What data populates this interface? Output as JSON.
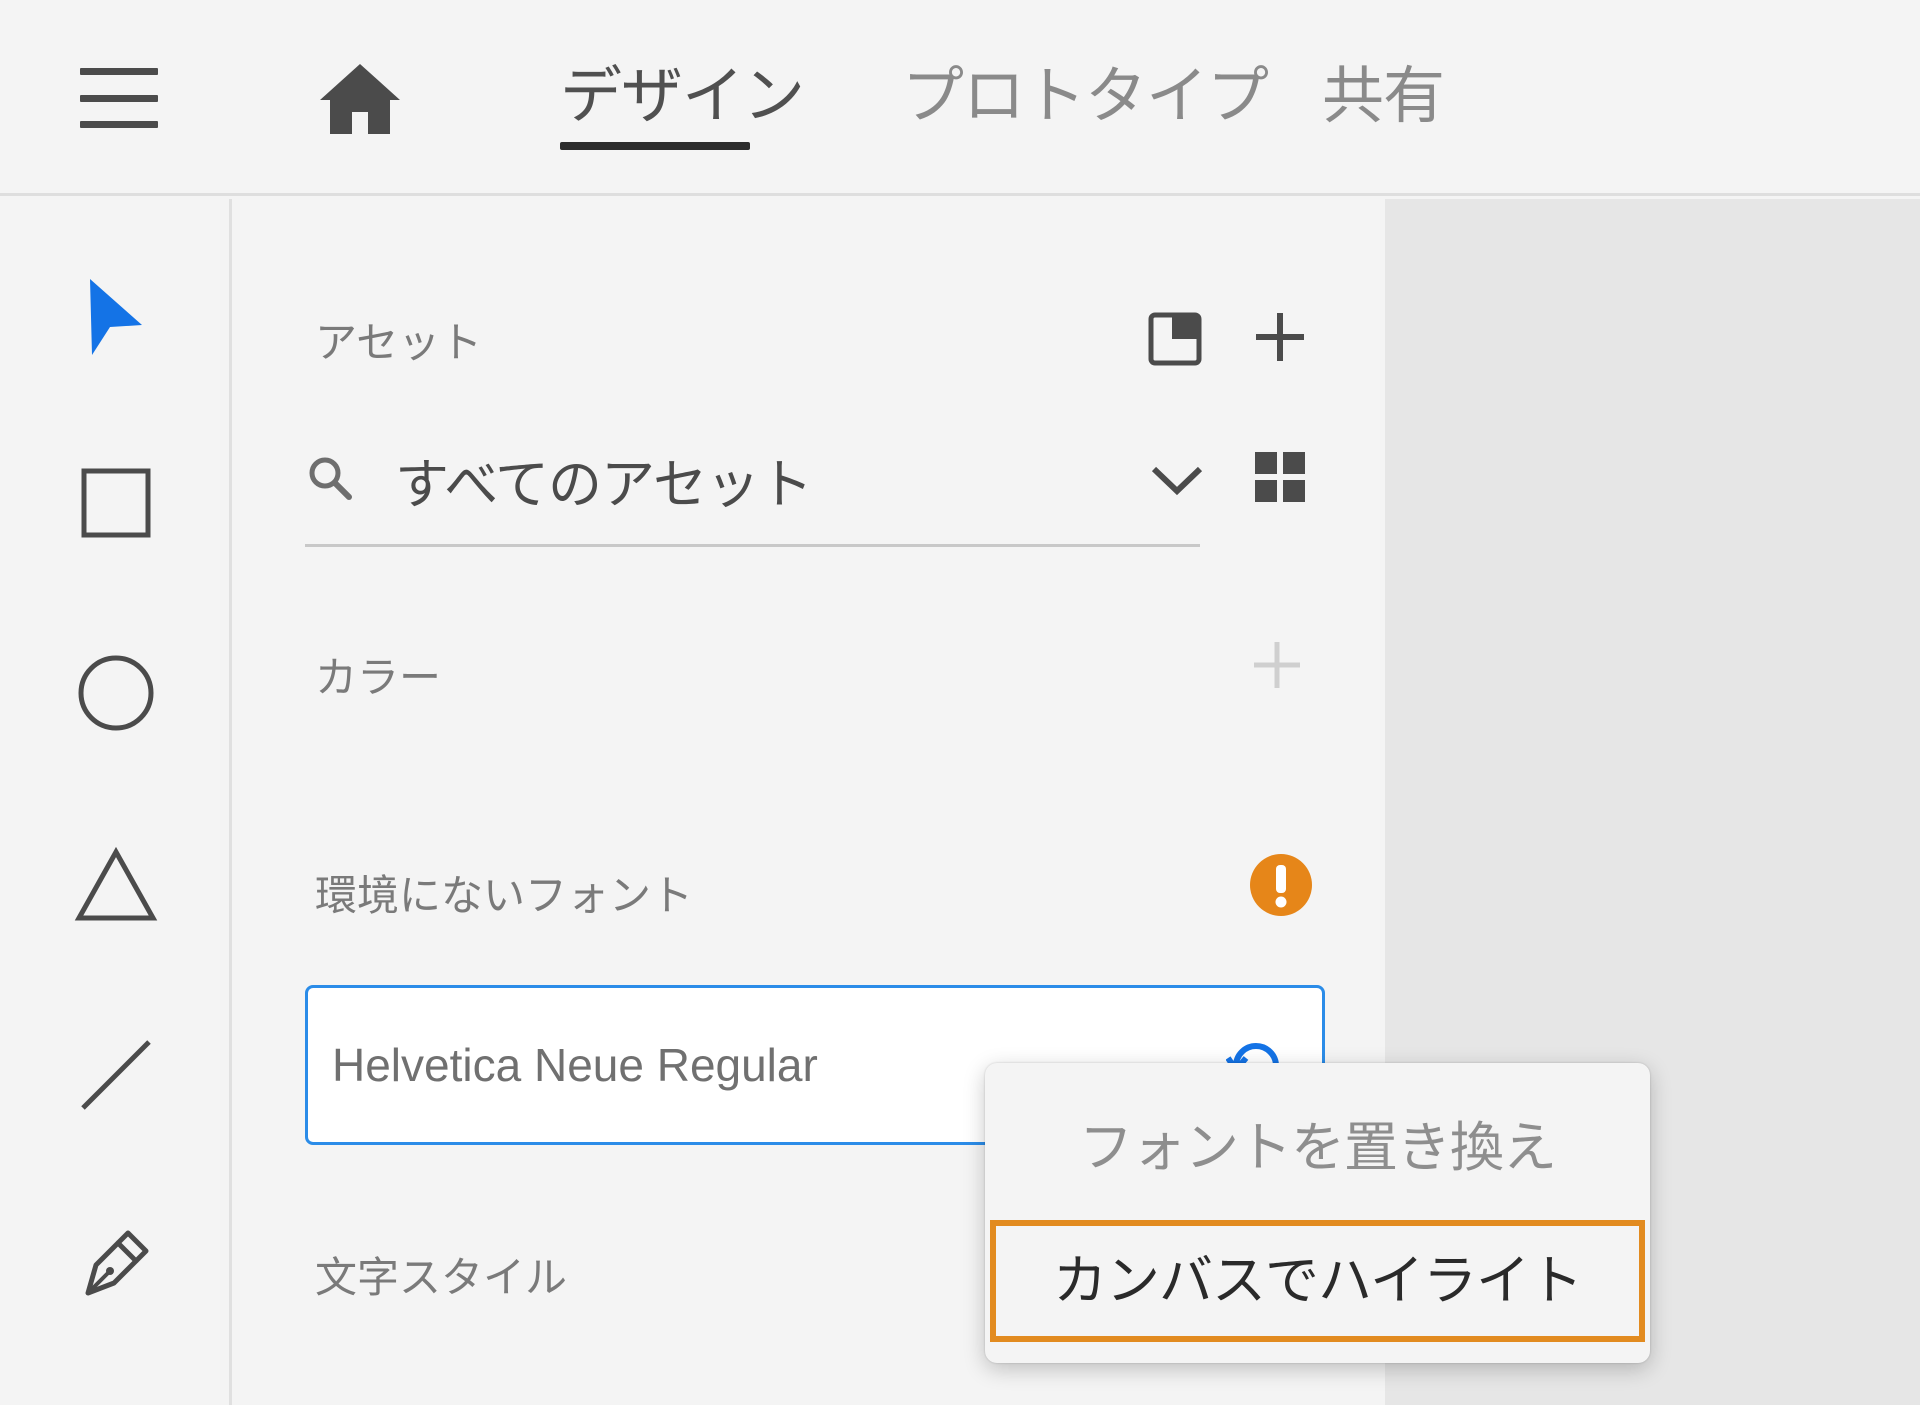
{
  "topbar": {
    "tabs": [
      {
        "label": "デザイン",
        "active": true
      },
      {
        "label": "プロトタイプ",
        "active": false
      },
      {
        "label": "共有",
        "active": false
      }
    ]
  },
  "toolbar": {
    "tools": [
      "select-tool",
      "rectangle-tool",
      "ellipse-tool",
      "triangle-tool",
      "line-tool",
      "pen-tool"
    ],
    "accent_color": "#1473e6"
  },
  "assets": {
    "title": "アセット",
    "search": {
      "value": "すべてのアセット"
    },
    "colors_label": "カラー",
    "missing_fonts_label": "環境にないフォント",
    "missing_font_name": "Helvetica Neue Regular",
    "character_styles_label": "文字スタイル",
    "warning_color": "#e68619"
  },
  "context_menu": {
    "items": [
      "フォントを置き換え",
      "カンバスでハイライト"
    ],
    "highlight_color": "#e28b20"
  }
}
